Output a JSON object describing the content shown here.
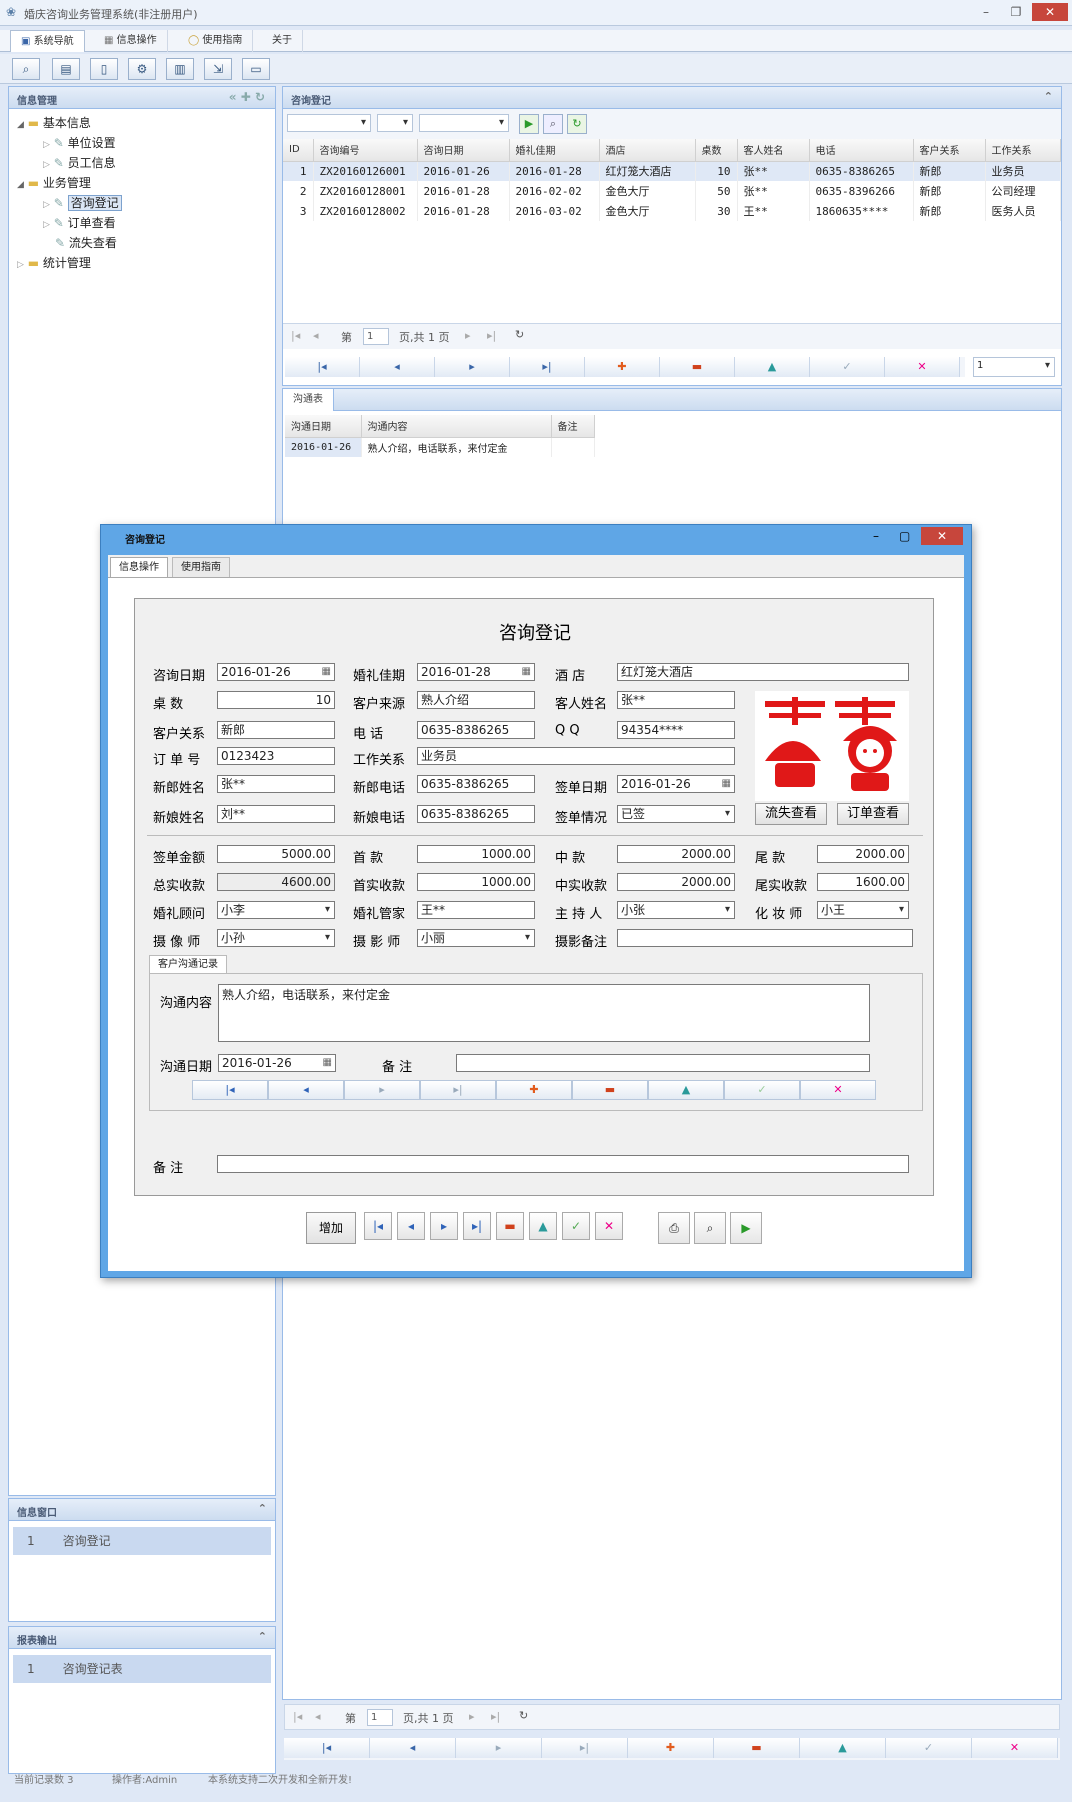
{
  "app": {
    "title": "婚庆咨询业务管理系统(非注册用户)",
    "min": "–",
    "restore": "❐",
    "close": "✕"
  },
  "main_tabs": [
    {
      "label": "系统导航"
    },
    {
      "label": "信息操作"
    },
    {
      "label": "使用指南"
    },
    {
      "label": "关于"
    }
  ],
  "toolbar_icons": [
    "search-icon",
    "table-icon",
    "document-icon",
    "tools-icon",
    "report-icon",
    "export-icon",
    "print-icon"
  ],
  "sidebar": {
    "title": "信息管理",
    "tree": [
      {
        "label": "基本信息"
      },
      {
        "label": "单位设置"
      },
      {
        "label": "员工信息"
      },
      {
        "label": "业务管理"
      },
      {
        "label": "咨询登记"
      },
      {
        "label": "订单查看"
      },
      {
        "label": "流失查看"
      },
      {
        "label": "统计管理"
      }
    ]
  },
  "info_window": {
    "title": "信息窗口",
    "row_index": "1",
    "row_label": "咨询登记"
  },
  "report_output": {
    "title": "报表输出",
    "row_index": "1",
    "row_label": "咨询登记表"
  },
  "status": {
    "records": "当前记录数 3",
    "operator": "操作者:Admin",
    "note": "本系统支持二次开发和全新开发!"
  },
  "consult_panel": {
    "title": "咨询登记",
    "columns": [
      "ID",
      "咨询编号",
      "咨询日期",
      "婚礼佳期",
      "酒店",
      "桌数",
      "客人姓名",
      "电话",
      "客户关系",
      "工作关系"
    ],
    "rows": [
      [
        "1",
        "ZX20160126001",
        "2016-01-26",
        "2016-01-28",
        "红灯笼大酒店",
        "10",
        "张**",
        "0635-8386265",
        "新郎",
        "业务员"
      ],
      [
        "2",
        "ZX20160128001",
        "2016-01-28",
        "2016-02-02",
        "金色大厅",
        "50",
        "张**",
        "0635-8396266",
        "新郎",
        "公司经理"
      ],
      [
        "3",
        "ZX20160128002",
        "2016-01-28",
        "2016-03-02",
        "金色大厅",
        "30",
        "王**",
        "1860635****",
        "新郎",
        "医务人员"
      ]
    ],
    "pager": {
      "page_prefix": "第",
      "page_value": "1",
      "page_suffix": "页,共 1 页"
    },
    "combo_value": "1"
  },
  "comm_panel": {
    "title": "沟通表",
    "columns": [
      "沟通日期",
      "沟通内容",
      "备注"
    ],
    "rows": [
      [
        "2016-01-26",
        "熟人介绍，电话联系，来付定金",
        ""
      ]
    ]
  },
  "bottom_pager": {
    "page_prefix": "第",
    "page_value": "1",
    "page_suffix": "页,共 1 页"
  },
  "dialog": {
    "title": "咨询登记",
    "tabs": [
      "信息操作",
      "使用指南"
    ],
    "form_title": "咨询登记",
    "labels": {
      "consult_date": "咨询日期",
      "wedding_date": "婚礼佳期",
      "hotel": "酒  店",
      "tables": "桌  数",
      "source": "客户来源",
      "guest_name": "客人姓名",
      "relation": "客户关系",
      "phone": "电  话",
      "qq": "Q Q",
      "order_no": "订 单 号",
      "work_rel": "工作关系",
      "groom_name": "新郎姓名",
      "groom_phone": "新郎电话",
      "sign_date": "签单日期",
      "bride_name": "新娘姓名",
      "bride_phone": "新娘电话",
      "sign_status": "签单情况",
      "sign_amount": "签单金额",
      "first_pay": "首  款",
      "mid_pay": "中  款",
      "final_pay": "尾  款",
      "total_recv": "总实收款",
      "first_recv": "首实收款",
      "mid_recv": "中实收款",
      "final_recv": "尾实收款",
      "advisor": "婚礼顾问",
      "steward": "婚礼管家",
      "host": "主 持 人",
      "makeup": "化 妆 师",
      "videographer": "摄 像 师",
      "photographer": "摄 影 师",
      "photo_note": "摄影备注",
      "remark": "备  注"
    },
    "values": {
      "consult_date": "2016-01-26",
      "wedding_date": "2016-01-28",
      "hotel": "红灯笼大酒店",
      "tables": "10",
      "source": "熟人介绍",
      "guest_name": "张**",
      "relation": "新郎",
      "phone": "0635-8386265",
      "qq": "94354****",
      "order_no": "0123423",
      "work_rel": "业务员",
      "groom_name": "张**",
      "groom_phone": "0635-8386265",
      "sign_date": "2016-01-26",
      "bride_name": "刘**",
      "bride_phone": "0635-8386265",
      "sign_status": "已签",
      "sign_amount": "5000.00",
      "first_pay": "1000.00",
      "mid_pay": "2000.00",
      "final_pay": "2000.00",
      "total_recv": "4600.00",
      "first_recv": "1000.00",
      "mid_recv": "2000.00",
      "final_recv": "1600.00",
      "advisor": "小李",
      "steward": "王**",
      "host": "小张",
      "makeup": "小王",
      "videographer": "小孙",
      "photographer": "小丽",
      "photo_note": "",
      "remark": ""
    },
    "buttons": {
      "lost_view": "流失查看",
      "order_view": "订单查看",
      "add": "增加"
    },
    "comm_section": {
      "title": "客户沟通记录",
      "content_label": "沟通内容",
      "content_value": "熟人介绍，电话联系，来付定金",
      "date_label": "沟通日期",
      "date_value": "2016-01-26",
      "note_label": "备  注",
      "note_value": ""
    }
  },
  "colors": {
    "accent": "#3c8cd8",
    "header_bg": "#dfe8f6",
    "close_red": "#c7463c",
    "selection": "#c9d9f0"
  }
}
